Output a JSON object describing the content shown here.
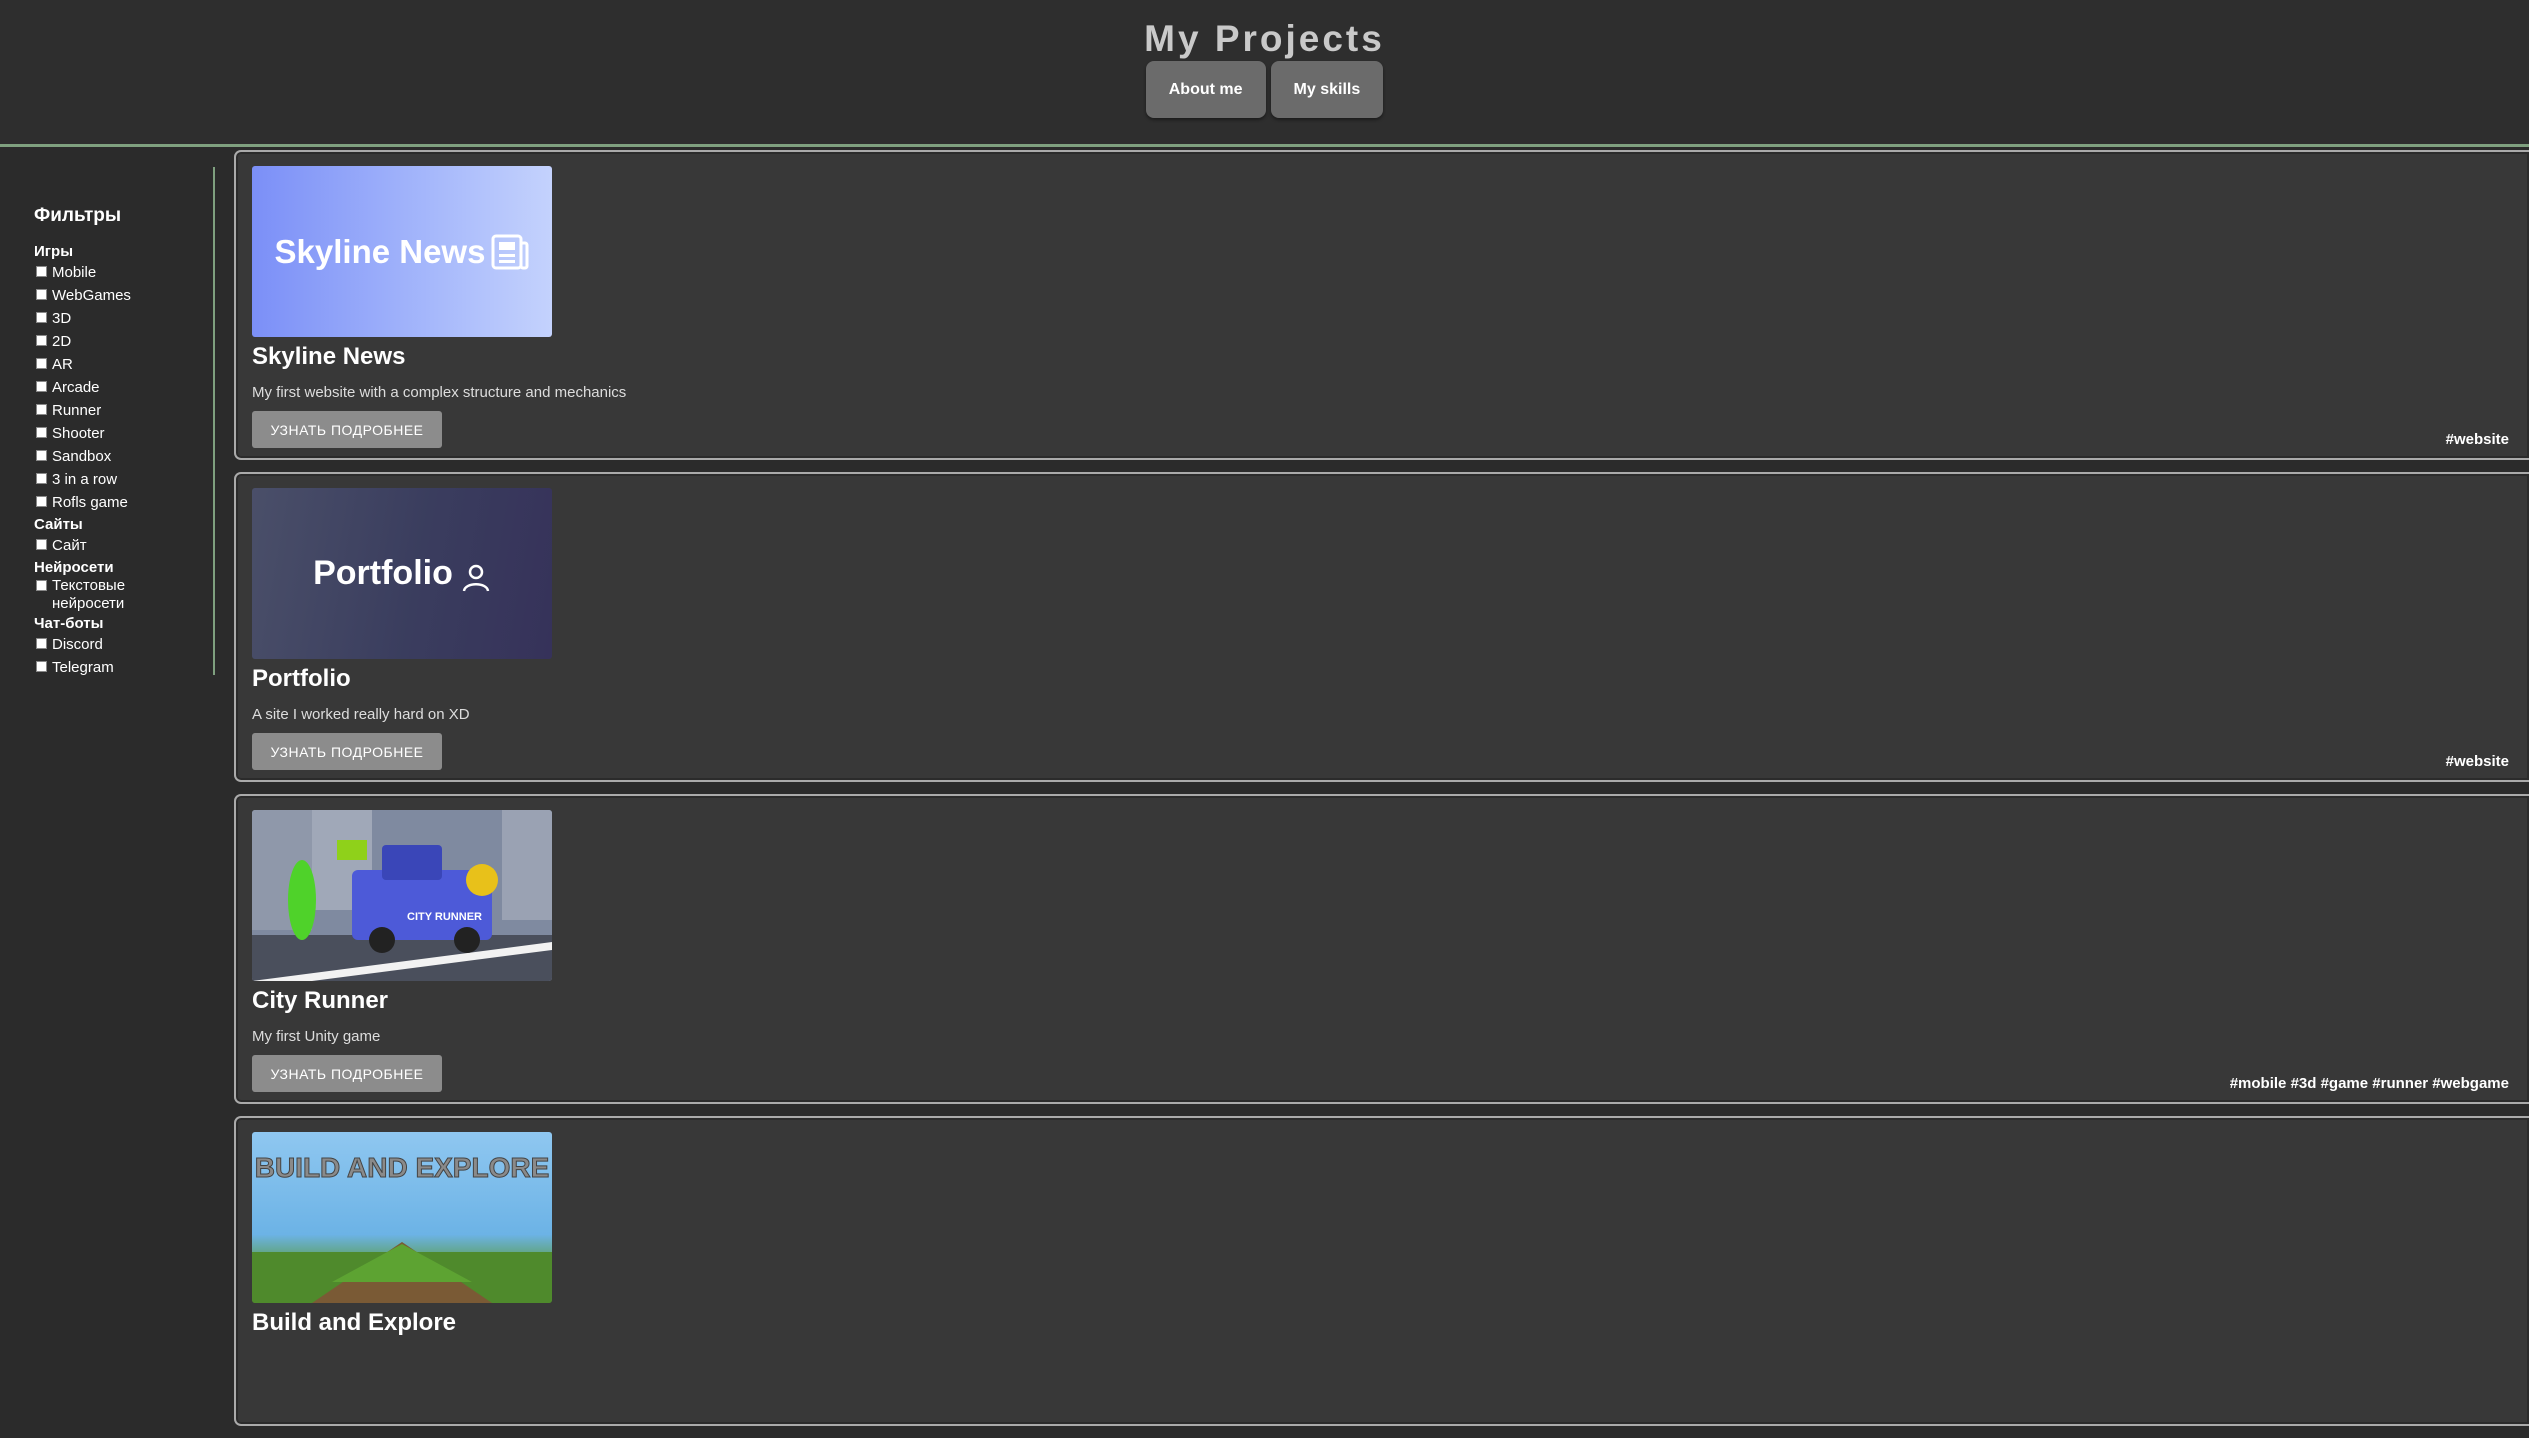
{
  "header": {
    "title": "My Projects",
    "nav": [
      "About me",
      "My skills"
    ]
  },
  "sidebar": {
    "title": "Фильтры",
    "groups": [
      {
        "name": "Игры",
        "options": [
          "Mobile",
          "WebGames",
          "3D",
          "2D",
          "AR",
          "Arcade",
          "Runner",
          "Shooter",
          "Sandbox",
          "3 in a row",
          "Rofls game"
        ]
      },
      {
        "name": "Сайты",
        "options": [
          "Сайт"
        ]
      },
      {
        "name": "Нейросети",
        "options": [
          "Текстовые нейросети"
        ]
      },
      {
        "name": "Чат-боты",
        "options": [
          "Discord",
          "Telegram"
        ]
      }
    ]
  },
  "projects": [
    {
      "title": "Skyline News",
      "description": "My first website with a complex structure and mechanics",
      "button": "УЗНАТЬ ПОДРОБНЕЕ",
      "tags": "#website",
      "thumb_text": "Skyline News"
    },
    {
      "title": "Portfolio",
      "description": "A site I worked really hard on XD",
      "button": "УЗНАТЬ ПОДРОБНЕЕ",
      "tags": "#website",
      "thumb_text": "Portfolio"
    },
    {
      "title": "City Runner",
      "description": "My first Unity game",
      "button": "УЗНАТЬ ПОДРОБНЕЕ",
      "tags": "#mobile #3d #game #runner #webgame",
      "thumb_text": "CITY RUNNER"
    },
    {
      "title": "Build and Explore",
      "description": "",
      "button": "",
      "tags": "",
      "thumb_text": "BUILD AND EXPLORE"
    }
  ],
  "icons": {
    "news": "newspaper-icon",
    "portfolio": "user-icon"
  },
  "colors": {
    "accent": "#7fa07f",
    "background": "#2b2b2b",
    "card": "#383838",
    "button": "#8c8c8c"
  }
}
